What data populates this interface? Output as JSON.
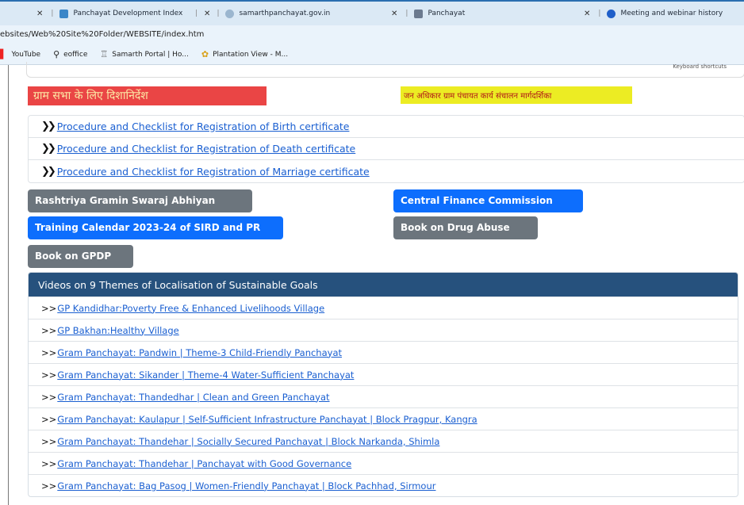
{
  "browser": {
    "tabs": [
      {
        "close": "✕",
        "title": "Panchayat Development Index",
        "favicon_color": "#3a86c8"
      },
      {
        "close": "✕",
        "title": "samarthpanchayat.gov.in",
        "favicon_color": "#9bb6cf"
      },
      {
        "close": "✕",
        "title": "Panchayat",
        "favicon_color": "#6b7a8f"
      },
      {
        "close": "✕",
        "title": "Meeting and webinar history",
        "favicon_color": "#1f5fc9"
      }
    ],
    "url": "ebsites/Web%20Site%20Folder/WEBSITE/index.htm",
    "bookmarks": [
      {
        "label": "YouTube",
        "icon": "youtube-icon"
      },
      {
        "label": "eoffice",
        "icon": "search-icon"
      },
      {
        "label": "Samarth Portal | Ho...",
        "icon": "emblem-icon"
      },
      {
        "label": "Plantation View - M...",
        "icon": "plant-icon"
      }
    ]
  },
  "map_card": {
    "shortcut_text": "Keyboard shortcuts"
  },
  "banners": {
    "gram_sabha": "ग्राम सभा के लिए दिशानिर्देश",
    "jan_adhikar": "जन अधिकार ग्राम पंचायत कार्य संचालन मार्गदर्शिका"
  },
  "checklist": {
    "arrow": "❯❯",
    "items": [
      "Procedure and Checklist for Registration of Birth certificate",
      "Procedure and Checklist for Registration of Death certificate",
      "Procedure and Checklist for Registration of Marriage certificate"
    ]
  },
  "buttons": {
    "rgsa": "Rashtriya Gramin Swaraj Abhiyan",
    "cfc": "Central Finance Commission",
    "training": "Training Calendar 2023-24 of SIRD and PR",
    "drug": "Book on Drug Abuse",
    "gpdp": "Book on GPDP"
  },
  "videos": {
    "heading": "Videos on 9 Themes of Localisation of Sustainable Goals",
    "prefix": ">>",
    "items": [
      "GP Kandidhar:Poverty Free & Enhanced Livelihoods Village",
      "GP Bakhan:Healthy Village",
      "Gram Panchayat: Pandwin | Theme-3 Child-Friendly Panchayat",
      "Gram Panchayat: Sikander | Theme-4 Water-Sufficient Panchayat",
      "Gram Panchayat: Thandedhar | Clean and Green Panchayat",
      "Gram Panchayat: Kaulapur | Self-Sufficient Infrastructure Panchayat | Block Pragpur, Kangra",
      "Gram Panchayat: Thandehar | Socially Secured Panchayat | Block Narkanda, Shimla",
      "Gram Panchayat: Thandehar | Panchayat with Good Governance",
      "Gram Panchayat: Bag Pasog | Women-Friendly Panchayat | Block Pachhad, Sirmour"
    ]
  },
  "colors": {
    "link": "#1a5fd1",
    "panel_header": "#26517d",
    "btn_gray": "#6c757d",
    "btn_blue": "#0d6efd",
    "banner_red": "#ea4545",
    "banner_yellow": "#ecec23"
  }
}
